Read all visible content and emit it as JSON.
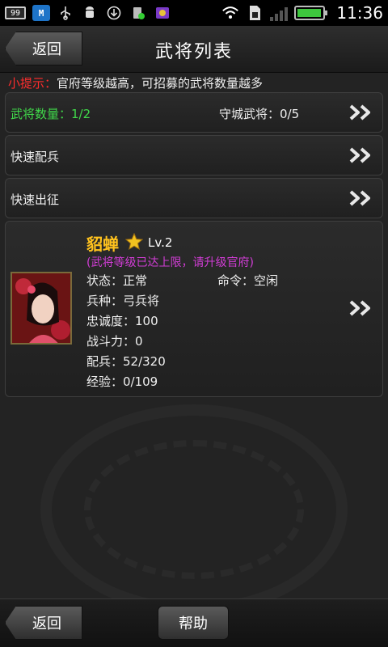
{
  "status_bar": {
    "notification_badge": "99",
    "time": "11:36",
    "icons": [
      "notification-count-icon",
      "m-app-icon",
      "usb-icon",
      "android-debug-icon",
      "download-icon",
      "sd-card-app-icon",
      "game-app-icon",
      "wifi-icon",
      "sim-card-icon",
      "signal-icon",
      "battery-icon"
    ],
    "battery_level": 0.95,
    "battery_color": "#3ec63e"
  },
  "header": {
    "back_label": "返回",
    "title": "武将列表"
  },
  "tip": {
    "label": "小提示：",
    "text": "官府等级越高，可招募的武将数量越多",
    "label_color": "#ff2d2d"
  },
  "summary": {
    "general_count": "武将数量：1/2",
    "garrison": "守城武将：0/5",
    "count_color": "#40d84a"
  },
  "menu": {
    "quick_assign": "快速配兵",
    "quick_march": "快速出征"
  },
  "general": {
    "name": "貂蝉",
    "level": "Lv.2",
    "limit_note": "(武将等级已达上限，请升级官府)",
    "status": "状态：正常",
    "command": "命令：空闲",
    "troop_type": "兵种：弓兵将",
    "loyalty": "忠诚度：100",
    "combat_power": "战斗力：0",
    "troops": "配兵：52/320",
    "experience": "经验：0/109",
    "name_color": "#ffc21e",
    "note_color": "#d23dd6"
  },
  "footer": {
    "back_label": "返回",
    "help_label": "帮助"
  }
}
